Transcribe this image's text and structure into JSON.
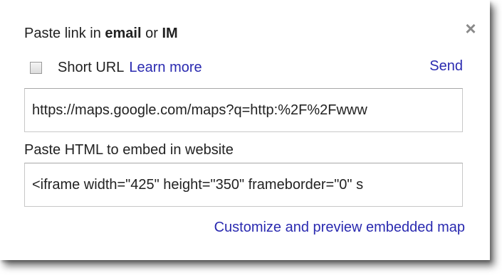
{
  "share": {
    "link_label_prefix": "Paste link in ",
    "link_label_email": "email",
    "link_label_or": " or ",
    "link_label_im": "IM",
    "close_glyph": "×",
    "short_url_label": "Short URL",
    "short_url_checked": false,
    "learn_more": "Learn more",
    "send": "Send",
    "link_value": "https://maps.google.com/maps?q=http:%2F%2Fwww",
    "embed_label": "Paste HTML to embed in website",
    "embed_value": "<iframe width=\"425\" height=\"350\" frameborder=\"0\" s",
    "customize_link": "Customize and preview embedded map"
  },
  "colors": {
    "link": "#2a2ab0",
    "text": "#222222",
    "close": "#8a8a8a",
    "border": "#c8c8c8"
  },
  "icons": {
    "close": "close-icon"
  }
}
